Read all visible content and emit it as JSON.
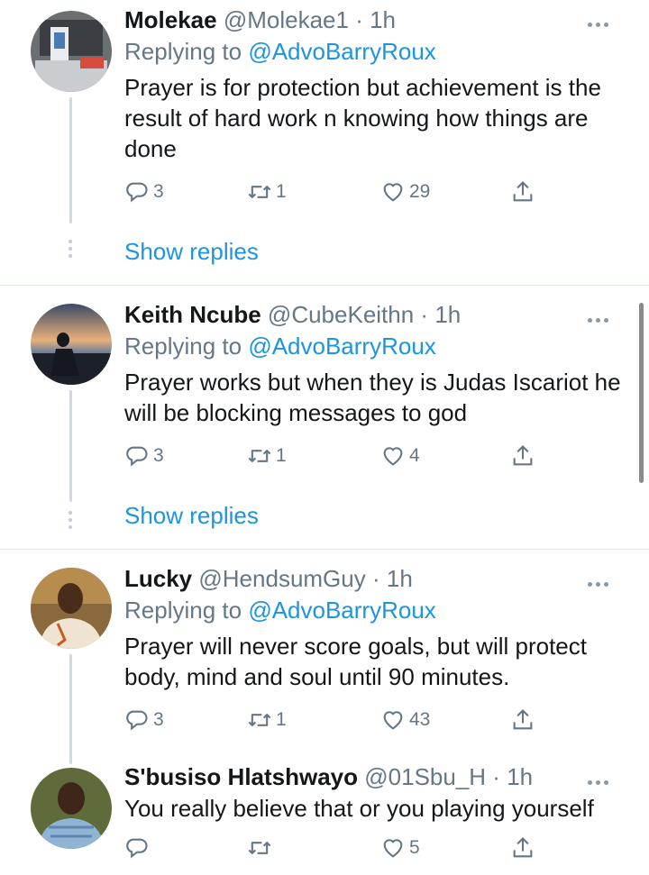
{
  "tweets": [
    {
      "name": "Molekae",
      "handle": "@Molekae1",
      "time": "1h",
      "replying_prefix": "Replying to",
      "replying_handle": "@AdvoBarryRoux",
      "text": "Prayer is for protection but achievement is the result of hard work n knowing how things are done",
      "replies": "3",
      "retweets": "1",
      "likes": "29",
      "show_replies": "Show replies"
    },
    {
      "name": "Keith Ncube",
      "handle": "@CubeKeithn",
      "time": "1h",
      "replying_prefix": "Replying to",
      "replying_handle": "@AdvoBarryRoux",
      "text": "Prayer works but when they is Judas Iscariot he will be blocking messages to god",
      "replies": "3",
      "retweets": "1",
      "likes": "4",
      "show_replies": "Show replies"
    },
    {
      "name": "Lucky",
      "handle": "@HendsumGuy",
      "time": "1h",
      "replying_prefix": "Replying to",
      "replying_handle": "@AdvoBarryRoux",
      "text": "Prayer will never score goals, but will protect body, mind and soul until 90 minutes.",
      "replies": "3",
      "retweets": "1",
      "likes": "43"
    },
    {
      "name": "S'busiso Hlatshwayo",
      "handle": "@01Sbu_H",
      "time": "1h",
      "text": "You really believe that or you playing yourself",
      "replies": "",
      "retweets": "",
      "likes": "5"
    }
  ],
  "colors": {
    "link": "#1b95e0",
    "muted": "#657786",
    "text": "#14171a"
  },
  "icons": [
    "reply-icon",
    "retweet-icon",
    "like-icon",
    "share-icon",
    "more-icon"
  ]
}
